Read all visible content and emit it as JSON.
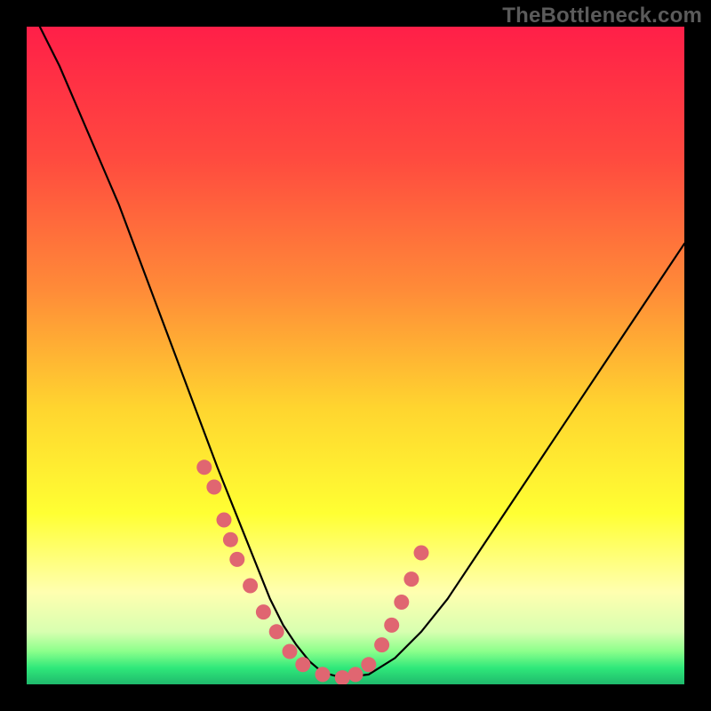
{
  "watermark": "TheBottleneck.com",
  "chart_data": {
    "type": "line",
    "title": "",
    "xlabel": "",
    "ylabel": "",
    "xlim": [
      0,
      100
    ],
    "ylim": [
      0,
      100
    ],
    "series": [
      {
        "name": "bottleneck-curve",
        "x": [
          2,
          5,
          8,
          11,
          14,
          17,
          20,
          23,
          26,
          29,
          31,
          33,
          35,
          37,
          39,
          41,
          43,
          45,
          48,
          52,
          56,
          60,
          64,
          68,
          72,
          76,
          80,
          84,
          88,
          92,
          96,
          100
        ],
        "values": [
          100,
          94,
          87,
          80,
          73,
          65,
          57,
          49,
          41,
          33,
          28,
          23,
          18,
          13,
          9,
          6,
          3.5,
          1.8,
          1,
          1.5,
          4,
          8,
          13,
          19,
          25,
          31,
          37,
          43,
          49,
          55,
          61,
          67
        ]
      }
    ],
    "optimal_band_ylim": [
      0,
      6
    ],
    "markers": {
      "name": "sample-points",
      "x": [
        27,
        28.5,
        30,
        31,
        32,
        34,
        36,
        38,
        40,
        42,
        45,
        48,
        50,
        52,
        54,
        55.5,
        57,
        58.5,
        60
      ],
      "values": [
        33,
        30,
        25,
        22,
        19,
        15,
        11,
        8,
        5,
        3,
        1.5,
        1,
        1.5,
        3,
        6,
        9,
        12.5,
        16,
        20
      ]
    },
    "gradient_stops": [
      {
        "pos": 0.0,
        "color": "#ff1f48"
      },
      {
        "pos": 0.2,
        "color": "#ff4a3f"
      },
      {
        "pos": 0.4,
        "color": "#ff8b38"
      },
      {
        "pos": 0.58,
        "color": "#ffd52f"
      },
      {
        "pos": 0.74,
        "color": "#ffff33"
      },
      {
        "pos": 0.86,
        "color": "#ffffb0"
      },
      {
        "pos": 0.92,
        "color": "#d8ffb0"
      },
      {
        "pos": 0.95,
        "color": "#8bff8b"
      },
      {
        "pos": 0.975,
        "color": "#2fe87a"
      },
      {
        "pos": 1.0,
        "color": "#1fb96c"
      }
    ]
  }
}
